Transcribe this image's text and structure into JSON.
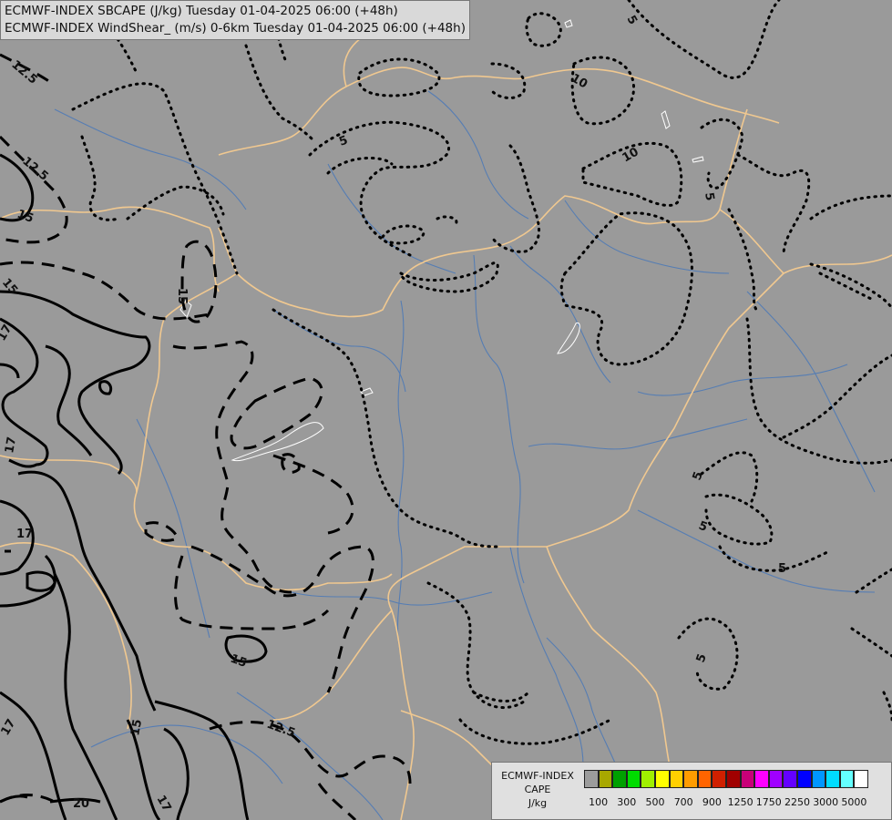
{
  "title": {
    "line1": "ECMWF-INDEX SBCAPE (J/kg) Tuesday 01-04-2025 06:00 (+48h)",
    "line2": "ECMWF-INDEX WindShear_ (m/s) 0-6km Tuesday 01-04-2025 06:00 (+48h)"
  },
  "legend": {
    "line1": "ECMWF-INDEX",
    "line2": "CAPE",
    "line3": "J/kg",
    "colors": [
      "#9c9c9c",
      "#a8a800",
      "#00a000",
      "#00dc00",
      "#a0f000",
      "#ffff00",
      "#ffd000",
      "#ff9c00",
      "#ff6400",
      "#d02000",
      "#a00000",
      "#c80078",
      "#ff00ff",
      "#a000ff",
      "#6400ff",
      "#0000ff",
      "#0096ff",
      "#00dcff",
      "#64ffff",
      "#ffffff"
    ],
    "ticks": [
      "100",
      "300",
      "500",
      "700",
      "900",
      "1250",
      "1750",
      "2250",
      "3000",
      "5000"
    ]
  },
  "contour_labels": [
    "5",
    "10",
    "10",
    "5",
    "5",
    "5",
    "5",
    "5",
    "5",
    "12.5",
    "12.5",
    "15",
    "15",
    "17",
    "17",
    "17",
    "17",
    "15",
    "15",
    "12.5",
    "20",
    "17",
    "15"
  ]
}
